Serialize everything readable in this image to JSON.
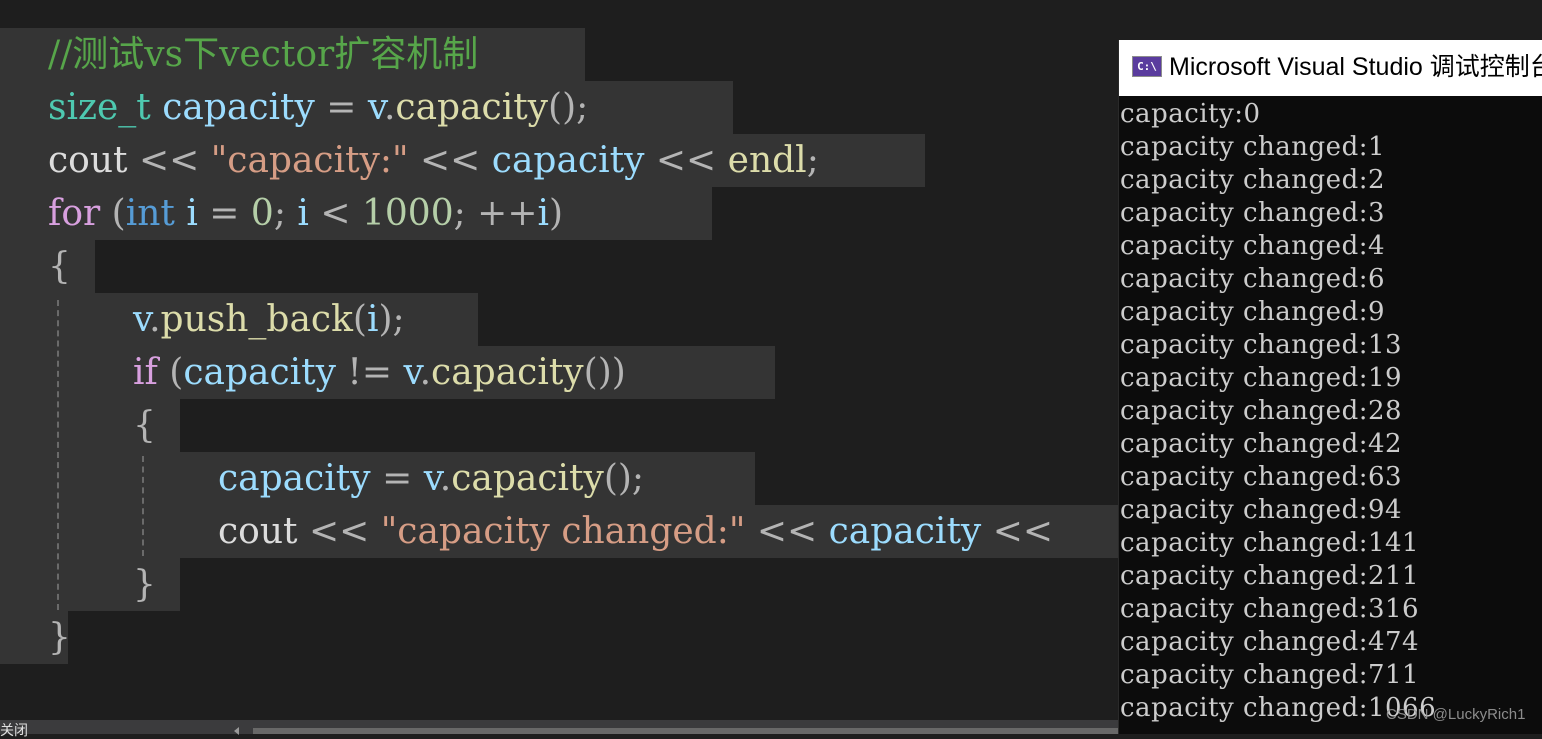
{
  "editor": {
    "lines": [
      {
        "tokens": [
          {
            "t": "//测试vs下vector扩容机制",
            "c": "c-comment"
          }
        ]
      },
      {
        "tokens": [
          {
            "t": "size_t",
            "c": "c-type"
          },
          {
            "t": " ",
            "c": "c-plain"
          },
          {
            "t": "capacity",
            "c": "c-var"
          },
          {
            "t": " = ",
            "c": "c-op"
          },
          {
            "t": "v",
            "c": "c-var"
          },
          {
            "t": ".",
            "c": "c-op"
          },
          {
            "t": "capacity",
            "c": "c-fn"
          },
          {
            "t": "();",
            "c": "c-op"
          }
        ]
      },
      {
        "tokens": [
          {
            "t": "cout",
            "c": "c-plain"
          },
          {
            "t": " << ",
            "c": "c-op"
          },
          {
            "t": "\"capacity:\"",
            "c": "c-str"
          },
          {
            "t": " << ",
            "c": "c-op"
          },
          {
            "t": "capacity",
            "c": "c-var"
          },
          {
            "t": " << ",
            "c": "c-op"
          },
          {
            "t": "endl",
            "c": "c-fn"
          },
          {
            "t": ";",
            "c": "c-op"
          }
        ]
      },
      {
        "tokens": [
          {
            "t": "for",
            "c": "c-kw"
          },
          {
            "t": " (",
            "c": "c-op"
          },
          {
            "t": "int",
            "c": "c-int"
          },
          {
            "t": " ",
            "c": "c-plain"
          },
          {
            "t": "i",
            "c": "c-var"
          },
          {
            "t": " = ",
            "c": "c-op"
          },
          {
            "t": "0",
            "c": "c-num"
          },
          {
            "t": "; ",
            "c": "c-op"
          },
          {
            "t": "i",
            "c": "c-var"
          },
          {
            "t": " < ",
            "c": "c-op"
          },
          {
            "t": "1000",
            "c": "c-num"
          },
          {
            "t": "; ++",
            "c": "c-op"
          },
          {
            "t": "i",
            "c": "c-var"
          },
          {
            "t": ")",
            "c": "c-op"
          }
        ]
      },
      {
        "tokens": [
          {
            "t": "{",
            "c": "c-op"
          }
        ]
      },
      {
        "tokens": [
          {
            "t": "v",
            "c": "c-var"
          },
          {
            "t": ".",
            "c": "c-op"
          },
          {
            "t": "push_back",
            "c": "c-fn"
          },
          {
            "t": "(",
            "c": "c-op"
          },
          {
            "t": "i",
            "c": "c-var"
          },
          {
            "t": ");",
            "c": "c-op"
          }
        ]
      },
      {
        "tokens": [
          {
            "t": "if",
            "c": "c-kw"
          },
          {
            "t": " (",
            "c": "c-op"
          },
          {
            "t": "capacity",
            "c": "c-var"
          },
          {
            "t": " != ",
            "c": "c-op"
          },
          {
            "t": "v",
            "c": "c-var"
          },
          {
            "t": ".",
            "c": "c-op"
          },
          {
            "t": "capacity",
            "c": "c-fn"
          },
          {
            "t": "())",
            "c": "c-op"
          }
        ]
      },
      {
        "tokens": [
          {
            "t": "{",
            "c": "c-op"
          }
        ]
      },
      {
        "tokens": [
          {
            "t": "capacity",
            "c": "c-var"
          },
          {
            "t": " = ",
            "c": "c-op"
          },
          {
            "t": "v",
            "c": "c-var"
          },
          {
            "t": ".",
            "c": "c-op"
          },
          {
            "t": "capacity",
            "c": "c-fn"
          },
          {
            "t": "();",
            "c": "c-op"
          }
        ]
      },
      {
        "tokens": [
          {
            "t": "cout",
            "c": "c-plain"
          },
          {
            "t": " << ",
            "c": "c-op"
          },
          {
            "t": "\"capacity changed:\"",
            "c": "c-str"
          },
          {
            "t": " << ",
            "c": "c-op"
          },
          {
            "t": "capacity",
            "c": "c-var"
          },
          {
            "t": " <<",
            "c": "c-op"
          }
        ]
      },
      {
        "tokens": [
          {
            "t": "}",
            "c": "c-op"
          }
        ]
      },
      {
        "tokens": [
          {
            "t": "}",
            "c": "c-op"
          }
        ]
      }
    ]
  },
  "bottom_panel": {
    "label": "关闭"
  },
  "console": {
    "title": "Microsoft Visual Studio 调试控制台",
    "icon_text": "C:\\",
    "output": [
      "capacity:0",
      "capacity changed:1",
      "capacity changed:2",
      "capacity changed:3",
      "capacity changed:4",
      "capacity changed:6",
      "capacity changed:9",
      "capacity changed:13",
      "capacity changed:19",
      "capacity changed:28",
      "capacity changed:42",
      "capacity changed:63",
      "capacity changed:94",
      "capacity changed:141",
      "capacity changed:211",
      "capacity changed:316",
      "capacity changed:474",
      "capacity changed:711",
      "capacity changed:1066"
    ]
  },
  "watermark": "CSDN @LuckyRich1"
}
